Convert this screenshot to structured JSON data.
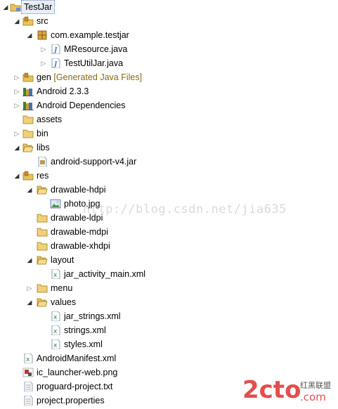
{
  "tree": {
    "project": "TestJar",
    "src": "src",
    "package": "com.example.testjar",
    "file_mresource": "MResource.java",
    "file_testutiljar": "TestUtilJar.java",
    "gen": "gen",
    "gen_decoration": "[Generated Java Files]",
    "android_lib": "Android 2.3.3",
    "android_deps": "Android Dependencies",
    "assets": "assets",
    "bin": "bin",
    "libs": "libs",
    "support_jar": "android-support-v4.jar",
    "res": "res",
    "drawable_hdpi": "drawable-hdpi",
    "photo": "photo.jpg",
    "drawable_ldpi": "drawable-ldpi",
    "drawable_mdpi": "drawable-mdpi",
    "drawable_xhdpi": "drawable-xhdpi",
    "layout": "layout",
    "jar_activity_main": "jar_activity_main.xml",
    "menu": "menu",
    "values": "values",
    "jar_strings": "jar_strings.xml",
    "strings": "strings.xml",
    "styles": "styles.xml",
    "manifest": "AndroidManifest.xml",
    "ic_launcher": "ic_launcher-web.png",
    "proguard": "proguard-project.txt",
    "project_properties": "project.properties"
  },
  "watermark": "http://blog.csdn.net/jia635",
  "logo": {
    "brand": "2cto",
    "domain": ".com",
    "tagline": "红黑联盟"
  },
  "colors": {
    "folder": "#e8c25a",
    "package": "#c98a2b",
    "java": "#4a7fc2",
    "decoration": "#8b6914",
    "selection": "#e8eef7"
  }
}
